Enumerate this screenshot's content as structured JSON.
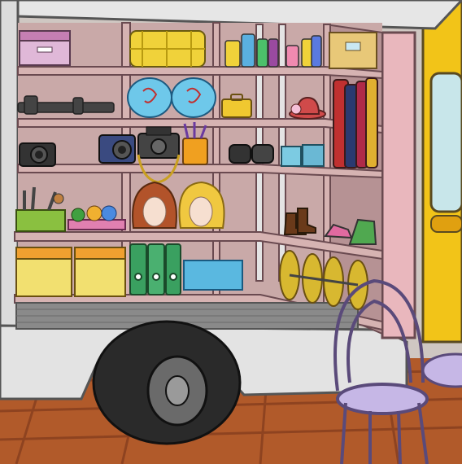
{
  "scene": {
    "name": "costume-truck-storage",
    "items": [
      {
        "id": "storage-box-pink",
        "icon": "box-icon"
      },
      {
        "id": "yellow-fabric-rolls",
        "icon": "fabric-roll-icon"
      },
      {
        "id": "bottles",
        "icon": "bottle-icon"
      },
      {
        "id": "cardboard-box",
        "icon": "box-icon"
      },
      {
        "id": "tripod",
        "icon": "tripod-icon"
      },
      {
        "id": "blue-pillows",
        "icon": "pillow-icon"
      },
      {
        "id": "yellow-case",
        "icon": "briefcase-icon"
      },
      {
        "id": "hat",
        "icon": "hat-icon"
      },
      {
        "id": "coats",
        "icon": "coat-icon"
      },
      {
        "id": "camera-1",
        "icon": "camera-icon"
      },
      {
        "id": "camera-2",
        "icon": "camera-icon"
      },
      {
        "id": "camera-3",
        "icon": "camera-icon"
      },
      {
        "id": "brush-cup",
        "icon": "brush-icon"
      },
      {
        "id": "lenses",
        "icon": "lens-icon"
      },
      {
        "id": "blue-boxes",
        "icon": "box-icon"
      },
      {
        "id": "tools-crate",
        "icon": "toolbox-icon"
      },
      {
        "id": "hair-accessories",
        "icon": "bow-icon"
      },
      {
        "id": "wig-brown",
        "icon": "wig-icon"
      },
      {
        "id": "wig-blonde",
        "icon": "wig-icon"
      },
      {
        "id": "boots",
        "icon": "boot-icon"
      },
      {
        "id": "sneakers",
        "icon": "shoe-icon"
      },
      {
        "id": "yellow-bins",
        "icon": "bin-icon"
      },
      {
        "id": "green-binders",
        "icon": "binder-icon"
      },
      {
        "id": "blue-tray",
        "icon": "tray-icon"
      },
      {
        "id": "film-reels",
        "icon": "film-reel-icon"
      },
      {
        "id": "chair",
        "icon": "chair-icon"
      },
      {
        "id": "wheel",
        "icon": "wheel-icon"
      }
    ]
  },
  "colors": {
    "wall": "#c9a9a8",
    "shelf": "#d6b3b2",
    "shelf_edge": "#a27d7f",
    "truck_body": "#d9d9d9",
    "truck_yellow": "#f2c418",
    "floor": "#b15a2a",
    "chair": "#c6b7e6"
  }
}
